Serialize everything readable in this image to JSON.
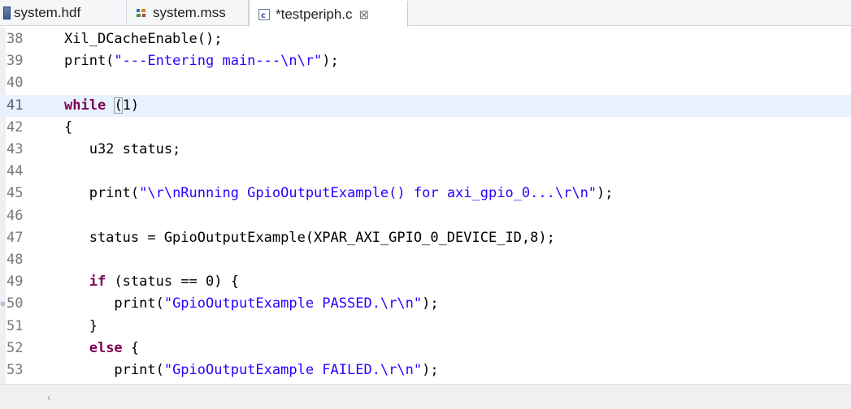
{
  "tabs": [
    {
      "label": "system.hdf",
      "icon": "hardware-file-icon",
      "active": false
    },
    {
      "label": "system.mss",
      "icon": "mss-file-icon",
      "active": false
    },
    {
      "label": "*testperiph.c",
      "icon": "c-file-icon",
      "active": true,
      "close_glyph": "⊠"
    }
  ],
  "editor": {
    "current_line": "41",
    "lines": [
      {
        "num": "38",
        "code": "Xil_DCacheEnable();"
      },
      {
        "num": "39",
        "code": "print(\"---Entering main---\\n\\r\");"
      },
      {
        "num": "40",
        "code": ""
      },
      {
        "num": "41",
        "code": "while (1)"
      },
      {
        "num": "42",
        "code": "{"
      },
      {
        "num": "43",
        "code": "   u32 status;"
      },
      {
        "num": "44",
        "code": ""
      },
      {
        "num": "45",
        "code": "   print(\"\\r\\nRunning GpioOutputExample() for axi_gpio_0...\\r\\n\");"
      },
      {
        "num": "46",
        "code": ""
      },
      {
        "num": "47",
        "code": "   status = GpioOutputExample(XPAR_AXI_GPIO_0_DEVICE_ID,8);"
      },
      {
        "num": "48",
        "code": ""
      },
      {
        "num": "49",
        "code": "   if (status == 0) {"
      },
      {
        "num": "50",
        "code": "      print(\"GpioOutputExample PASSED.\\r\\n\");"
      },
      {
        "num": "51",
        "code": "   }"
      },
      {
        "num": "52",
        "code": "   else {"
      },
      {
        "num": "53",
        "code": "      print(\"GpioOutputExample FAILED.\\r\\n\");"
      }
    ]
  },
  "scrollbar": {
    "left_arrow": "‹"
  },
  "colors": {
    "keyword": "#7f0055",
    "string": "#2a00ff",
    "line_number": "#787878",
    "current_line_bg": "#e8f2fe"
  }
}
